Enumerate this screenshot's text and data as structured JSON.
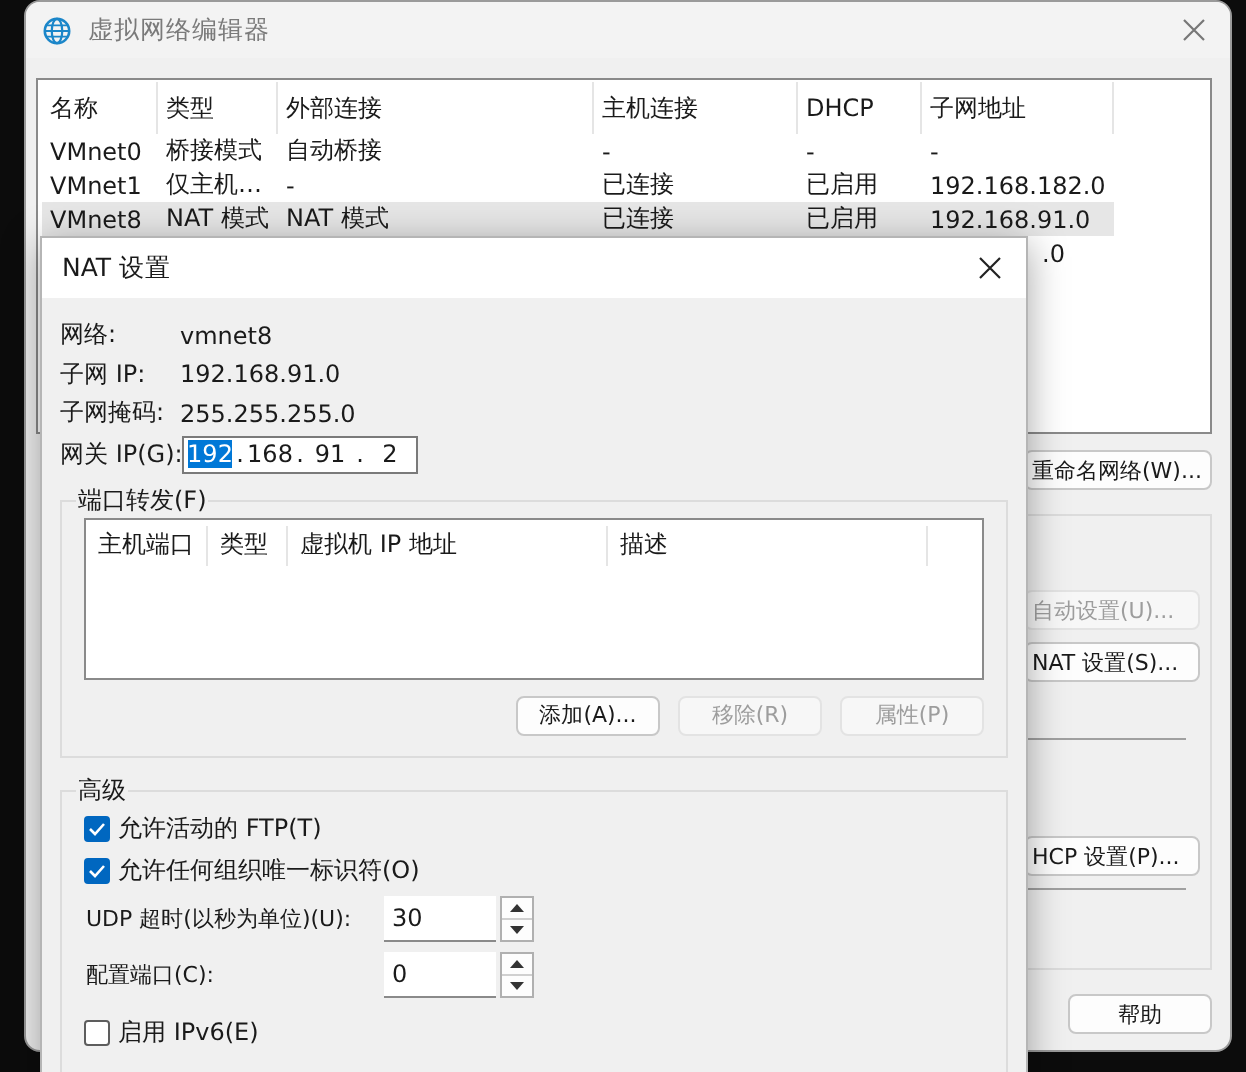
{
  "background_window": {
    "title": "虚拟网络编辑器",
    "table": {
      "columns": [
        "名称",
        "类型",
        "外部连接",
        "主机连接",
        "DHCP",
        "子网地址"
      ],
      "rows": [
        {
          "cells": [
            "VMnet0",
            "桥接模式",
            "自动桥接",
            "-",
            "-",
            "-"
          ],
          "selected": false
        },
        {
          "cells": [
            "VMnet1",
            "仅主机…",
            "-",
            "已连接",
            "已启用",
            "192.168.182.0"
          ],
          "selected": false
        },
        {
          "cells": [
            "VMnet8",
            "NAT 模式",
            "NAT 模式",
            "已连接",
            "已启用",
            "192.168.91.0"
          ],
          "selected": true
        }
      ],
      "partial_row_subnet": ".0"
    },
    "rename_button": {
      "label": "重命名网络(W)...",
      "disabled": false
    },
    "group_buttons": [
      {
        "label": "自动设置(U)...",
        "disabled": true
      },
      {
        "label": "NAT 设置(S)...",
        "disabled": false
      }
    ],
    "dhcp_button": {
      "label": "HCP 设置(P)...",
      "disabled": false
    },
    "help_button": {
      "label": "帮助",
      "disabled": false
    }
  },
  "nat_dialog": {
    "title": "NAT 设置",
    "info": [
      {
        "label": "网络:",
        "value": "vmnet8"
      },
      {
        "label": "子网 IP:",
        "value": "192.168.91.0"
      },
      {
        "label": "子网掩码:",
        "value": "255.255.255.0"
      }
    ],
    "gateway": {
      "label": "网关 IP(G):",
      "separator": ".",
      "octets": [
        {
          "text": "192",
          "selected": true
        },
        {
          "text": "168",
          "selected": false
        },
        {
          "text": "91",
          "selected": false
        },
        {
          "text": "2",
          "selected": false
        }
      ]
    },
    "port_forwarding": {
      "title": "端口转发(F)",
      "columns": [
        "主机端口",
        "类型",
        "虚拟机 IP 地址",
        "描述"
      ],
      "buttons": [
        {
          "label": "添加(A)...",
          "disabled": false
        },
        {
          "label": "移除(R)",
          "disabled": true
        },
        {
          "label": "属性(P)",
          "disabled": true
        }
      ]
    },
    "advanced": {
      "title": "高级",
      "options": [
        {
          "kind": "checkbox",
          "label": "允许活动的 FTP(T)",
          "checked": true
        },
        {
          "kind": "checkbox",
          "label": "允许任何组织唯一标识符(O)",
          "checked": true
        },
        {
          "kind": "spinner",
          "label": "UDP 超时(以秒为单位)(U):",
          "value": "30"
        },
        {
          "kind": "spinner",
          "label": "配置端口(C):",
          "value": "0"
        },
        {
          "kind": "checkbox",
          "label": "启用 IPv6(E)",
          "checked": false
        }
      ]
    }
  }
}
